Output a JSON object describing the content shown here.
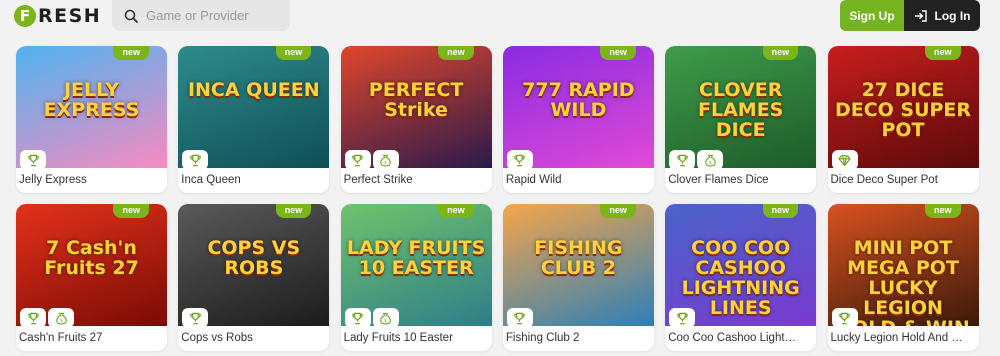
{
  "header": {
    "logo_letter": "F",
    "logo_text": "RESH",
    "search_placeholder": "Game or Provider",
    "signup_label": "Sign Up",
    "login_label": "Log In"
  },
  "colors": {
    "accent": "#7cb518",
    "dark": "#222222"
  },
  "badge_label": "new",
  "games": [
    {
      "name": "Jelly Express",
      "art": "JELLY EXPRESS",
      "bg": [
        "#4fb3f0",
        "#f78bc0"
      ],
      "features": [
        "trophy-icon"
      ]
    },
    {
      "name": "Inca Queen",
      "art": "INCA QUEEN",
      "bg": [
        "#2e8b8b",
        "#0f4f57"
      ],
      "features": [
        "trophy-icon"
      ]
    },
    {
      "name": "Perfect Strike",
      "art": "PERFECT Strike",
      "bg": [
        "#e0462c",
        "#2b1a4a"
      ],
      "features": [
        "trophy-icon",
        "money-bag-icon"
      ]
    },
    {
      "name": "Rapid Wild",
      "art": "777 RAPID WILD",
      "bg": [
        "#8a2be2",
        "#e14ad6"
      ],
      "features": [
        "trophy-icon"
      ]
    },
    {
      "name": "Clover Flames Dice",
      "art": "CLOVER FLAMES DICE",
      "bg": [
        "#3f9d4a",
        "#1d5b2a"
      ],
      "features": [
        "trophy-icon",
        "money-bag-icon"
      ]
    },
    {
      "name": "Dice Deco Super Pot",
      "art": "27 DICE DECO SUPER POT",
      "bg": [
        "#c81e1e",
        "#5a0a0a"
      ],
      "features": [
        "diamond-icon"
      ]
    },
    {
      "name": "Cash'n Fruits 27",
      "art": "7 Cash'n Fruits 27",
      "bg": [
        "#e4321b",
        "#7a0b05"
      ],
      "features": [
        "trophy-icon",
        "money-bag-icon"
      ]
    },
    {
      "name": "Cops vs Robs",
      "art": "COPS VS ROBS",
      "bg": [
        "#5a5a5a",
        "#1c1c1c"
      ],
      "features": [
        "trophy-icon"
      ]
    },
    {
      "name": "Lady Fruits 10 Easter",
      "art": "LADY FRUITS 10 EASTER",
      "bg": [
        "#6fc36b",
        "#2f7e8a"
      ],
      "features": [
        "trophy-icon",
        "money-bag-icon"
      ]
    },
    {
      "name": "Fishing Club 2",
      "art": "FISHING CLUB 2",
      "bg": [
        "#f5a64a",
        "#2d7fb8"
      ],
      "features": [
        "trophy-icon"
      ]
    },
    {
      "name": "Coo Coo Cashoo Light…",
      "art": "COO COO CASHOO LIGHTNING LINES",
      "bg": [
        "#4a63c9",
        "#7a3bd0"
      ],
      "features": [
        "trophy-icon"
      ]
    },
    {
      "name": "Lucky Legion Hold And …",
      "art": "MINI POT MEGA POT LUCKY LEGION HOLD & WIN",
      "bg": [
        "#d8521f",
        "#3a1a0a"
      ],
      "features": [
        "trophy-icon"
      ]
    }
  ]
}
